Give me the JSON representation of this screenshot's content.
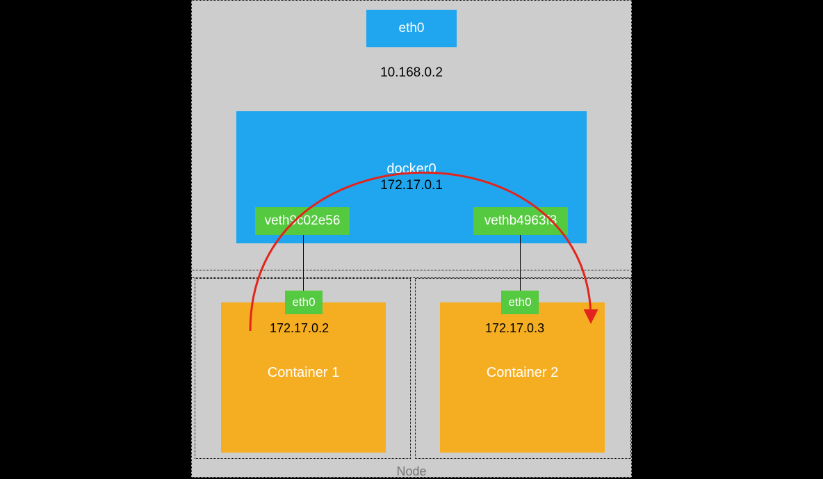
{
  "node": {
    "label": "Node",
    "host_interface": {
      "name": "eth0",
      "ip": "10.168.0.2"
    },
    "bridge": {
      "name": "docker0",
      "ip": "172.17.0.1",
      "veths": [
        "veth9c02e56",
        "vethb4963f3"
      ]
    },
    "containers": [
      {
        "label": "Container 1",
        "iface": "eth0",
        "ip": "172.17.0.2"
      },
      {
        "label": "Container  2",
        "iface": "eth0",
        "ip": "172.17.0.3"
      }
    ]
  },
  "colors": {
    "node_bg": "#cdcdcd",
    "blue": "#20a6ee",
    "green": "#55c93f",
    "orange": "#f5ae22",
    "arrow": "#e2241d"
  }
}
